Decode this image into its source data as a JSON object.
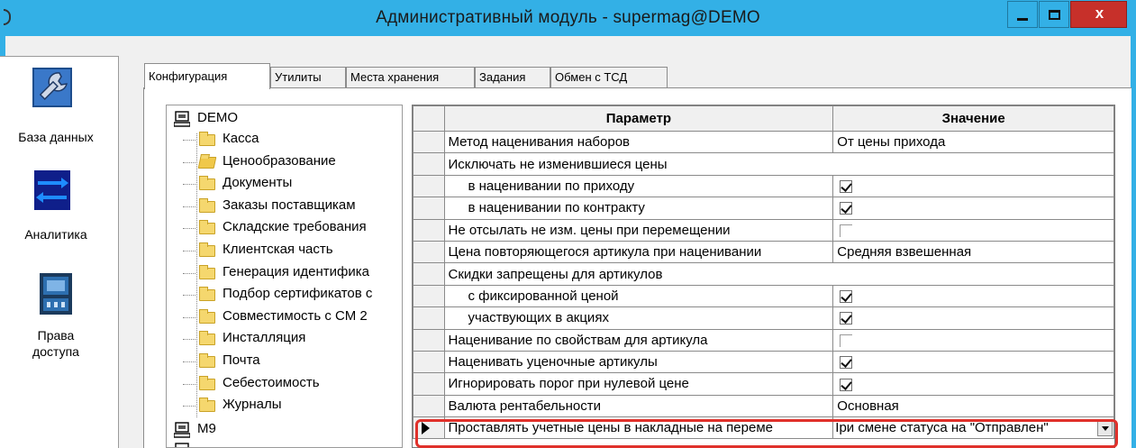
{
  "window": {
    "title": "Административный модуль - supermag@DEMO",
    "buttons": {
      "minimize": "minimize",
      "maximize": "maximize",
      "close": "x"
    }
  },
  "nav": [
    {
      "label": "База данных",
      "icon": "wrench-icon"
    },
    {
      "label": "Аналитика",
      "icon": "arrows-icon"
    },
    {
      "label_line1": "Права",
      "label_line2": "доступа",
      "icon": "access-rights-icon"
    }
  ],
  "tabs": [
    {
      "label": "Конфигурация",
      "active": true
    },
    {
      "label": "Утилиты"
    },
    {
      "label": "Места хранения"
    },
    {
      "label": "Задания"
    },
    {
      "label": "Обмен с ТСД"
    }
  ],
  "tree": {
    "root": "DEMO",
    "items": [
      "Касса",
      "Ценообразование",
      "Документы",
      "Заказы поставщикам",
      "Складские требования",
      "Клиентская часть",
      "Генерация идентифика",
      "Подбор сертификатов с",
      "Совместимость с СМ 2",
      "Инсталляция",
      "Почта",
      "Себестоимость",
      "Журналы"
    ],
    "selected_index": 1,
    "second_root": "M9"
  },
  "grid": {
    "headers": {
      "param": "Параметр",
      "value": "Значение"
    },
    "rows": [
      {
        "param": "Метод наценивания наборов",
        "value": "От цены прихода"
      },
      {
        "param": "Исключать не изменившиеся цены",
        "group": true
      },
      {
        "param": "в наценивании по приходу",
        "indent": true,
        "check": true
      },
      {
        "param": "в наценивании по контракту",
        "indent": true,
        "check": true
      },
      {
        "param": "Не отсылать не изм. цены при перемещении",
        "check": false
      },
      {
        "param": "Цена повторяющегося артикула при наценивании",
        "value": "Средняя взвешенная"
      },
      {
        "param": "Скидки запрещены для артикулов",
        "group": true
      },
      {
        "param": "с фиксированной ценой",
        "indent": true,
        "check": true
      },
      {
        "param": "участвующих в акциях",
        "indent": true,
        "check": true
      },
      {
        "param": "Наценивание по свойствам для артикула",
        "check": false
      },
      {
        "param": "Наценивать уценочные артикулы",
        "check": true
      },
      {
        "param": "Игнорировать порог при нулевой цене",
        "check": true
      },
      {
        "param": "Валюта рентабельности",
        "value": "Основная"
      },
      {
        "param": "Проставлять учетные цены в накладные на переме",
        "value": "Iри смене статуса на \"Отправлен\"",
        "current": true
      }
    ]
  }
}
